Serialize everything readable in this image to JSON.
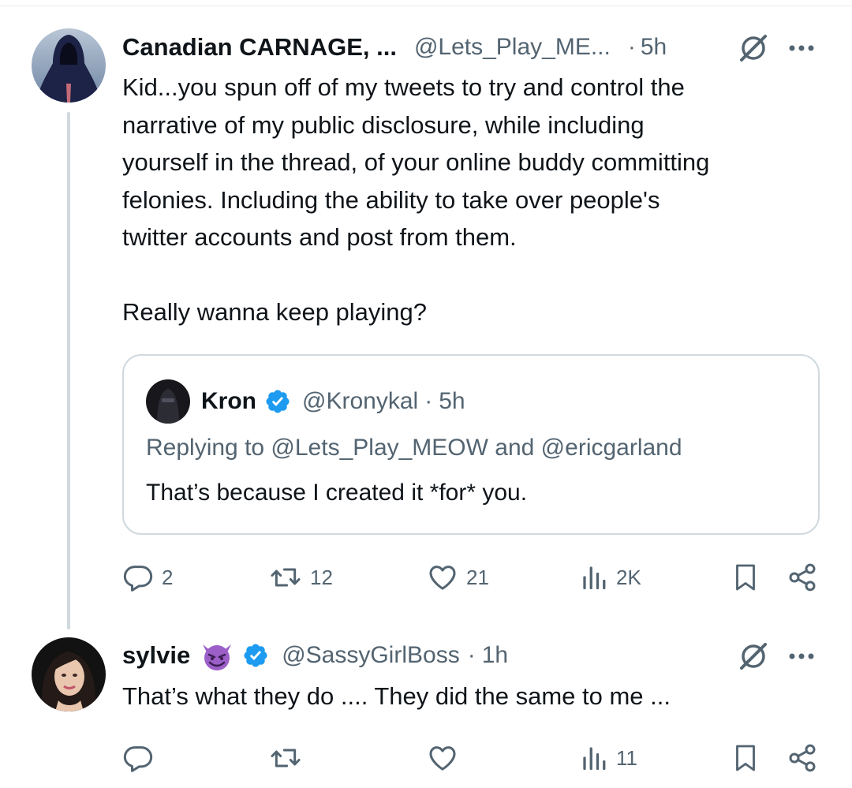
{
  "tweets": [
    {
      "name": "Canadian CARNAGE, ...",
      "handle": "@Lets_Play_ME...",
      "separator": "·",
      "time": "5h",
      "text_lines": [
        "Kid...you spun off of my tweets to try and control the",
        "narrative of my public disclosure, while including",
        "yourself in the thread, of your online buddy committing",
        "felonies. Including the ability to take over people's",
        "twitter accounts and post from them."
      ],
      "text_last": "Really wanna keep playing?",
      "quote": {
        "name": "Kron",
        "handle": "@Kronykal",
        "separator": "·",
        "time": "5h",
        "replying": "Replying to @Lets_Play_MEOW and @ericgarland",
        "text": "That’s because I created it *for* you."
      },
      "actions": {
        "replies": "2",
        "retweets": "12",
        "likes": "21",
        "views": "2K"
      }
    },
    {
      "name": "sylvie",
      "emoji": "😈",
      "handle": "@SassyGirlBoss",
      "separator": "·",
      "time": "1h",
      "text": "That’s what they do .... They did the same to me ...",
      "actions": {
        "replies": "",
        "retweets": "",
        "likes": "",
        "views": "11"
      }
    }
  ],
  "icons": {
    "grok": "grok-icon",
    "more": "more-icon",
    "verified": "verified-badge-icon",
    "reply": "reply-icon",
    "retweet": "retweet-icon",
    "like": "like-icon",
    "views": "views-icon",
    "bookmark": "bookmark-icon",
    "share": "share-icon"
  },
  "colors": {
    "text": "#0f1419",
    "secondary": "#536471",
    "verified": "#1d9bf0",
    "border": "#cfd9de"
  }
}
